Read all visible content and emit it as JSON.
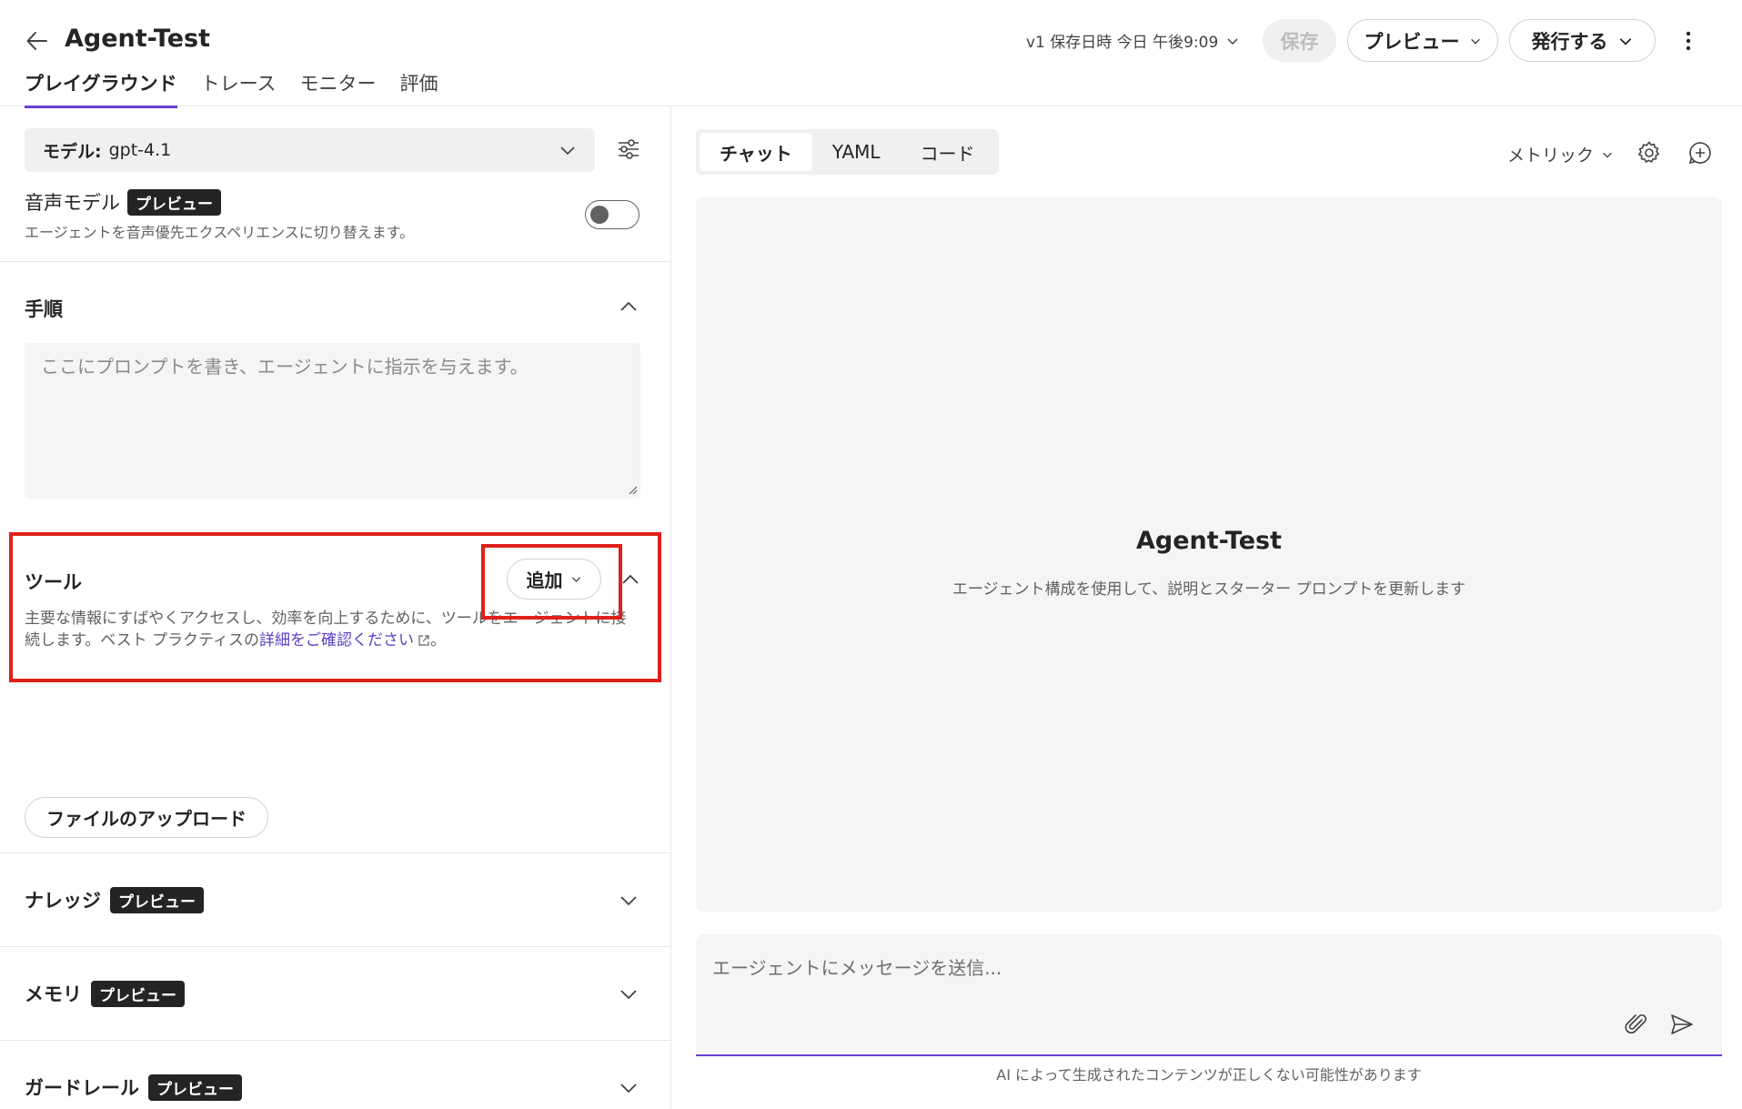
{
  "header": {
    "title": "Agent-Test",
    "tabs": [
      {
        "label": "プレイグラウンド",
        "active": true
      },
      {
        "label": "トレース"
      },
      {
        "label": "モニター"
      },
      {
        "label": "評価"
      }
    ],
    "save_info": "v1 保存日時 今日 午後9:09",
    "save_label": "保存",
    "preview_label": "プレビュー",
    "publish_label": "発行する"
  },
  "left": {
    "model_label": "モデル:",
    "model_value": "gpt-4.1",
    "voice_title": "音声モデル",
    "voice_badge": "プレビュー",
    "voice_desc": "エージェントを音声優先エクスペリエンスに切り替えます。",
    "voice_enabled": false,
    "instructions_title": "手順",
    "instructions_placeholder": "ここにプロンプトを書き、エージェントに指示を与えます。",
    "tools_title": "ツール",
    "tools_add_label": "追加",
    "tools_desc": "主要な情報にすばやくアクセスし、効率を向上するために、ツールをエージェントに接続します。ベスト プラクティスの",
    "tools_link": "詳細をご確認ください",
    "tools_desc_end": "。",
    "upload_label": "ファイルのアップロード",
    "knowledge_title": "ナレッジ",
    "knowledge_badge": "プレビュー",
    "memory_title": "メモリ",
    "memory_badge": "プレビュー",
    "guardrails_title": "ガードレール",
    "guardrails_badge": "プレビュー"
  },
  "right": {
    "tabs": [
      {
        "label": "チャット",
        "active": true
      },
      {
        "label": "YAML"
      },
      {
        "label": "コード"
      }
    ],
    "metrics_label": "メトリック",
    "agent_name": "Agent-Test",
    "agent_desc": "エージェント構成を使用して、説明とスターター プロンプトを更新します",
    "composer_placeholder": "エージェントにメッセージを送信...",
    "disclaimer": "AI によって生成されたコンテンツが正しくない可能性があります"
  },
  "colors": {
    "accent": "#6b3fd6",
    "link": "#5b3fc7",
    "highlight": "#e0201b",
    "badge_bg": "#242424"
  },
  "icons": [
    "back-arrow-icon",
    "chevron-down-icon",
    "more-vertical-icon",
    "tune-icon",
    "chevron-up-icon",
    "external-link-icon",
    "gear-icon",
    "add-chat-icon",
    "attach-icon",
    "send-icon"
  ]
}
